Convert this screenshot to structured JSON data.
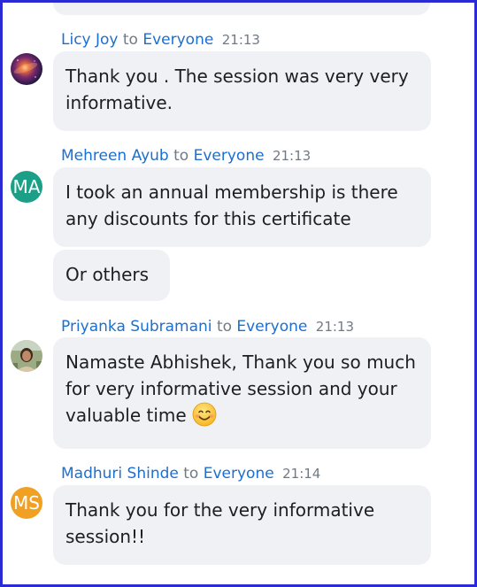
{
  "colors": {
    "frame_border": "#2b2bd6",
    "link_blue": "#1b6fd1",
    "muted_gray": "#707a85",
    "bubble_bg": "#f0f1f4",
    "avatar_teal": "#1ba087",
    "avatar_orange": "#f0a023"
  },
  "messages": [
    {
      "sender": "Licy Joy",
      "to_text": "to",
      "recipient": "Everyone",
      "time": "21:13",
      "avatar": {
        "type": "image",
        "icon": "galaxy-photo-avatar"
      },
      "bubbles": [
        "Thank you .  The session was very very informative."
      ]
    },
    {
      "sender": "Mehreen Ayub",
      "to_text": "to",
      "recipient": "Everyone",
      "time": "21:13",
      "avatar": {
        "type": "initials",
        "text": "MA",
        "color": "#1ba087"
      },
      "bubbles": [
        "I took an annual membership is there any discounts for this certificate",
        "Or others"
      ]
    },
    {
      "sender": "Priyanka Subramani",
      "to_text": "to",
      "recipient": "Everyone",
      "time": "21:13",
      "avatar": {
        "type": "image",
        "icon": "person-photo-avatar"
      },
      "bubbles": [
        "Namaste Abhishek, Thank you so much for very informative session and your valuable time"
      ],
      "emoji": "smiling-face-emoji"
    },
    {
      "sender": "Madhuri Shinde",
      "to_text": "to",
      "recipient": "Everyone",
      "time": "21:14",
      "avatar": {
        "type": "initials",
        "text": "MS",
        "color": "#f0a023"
      },
      "bubbles": [
        "Thank you for the very informative session!!"
      ]
    }
  ]
}
